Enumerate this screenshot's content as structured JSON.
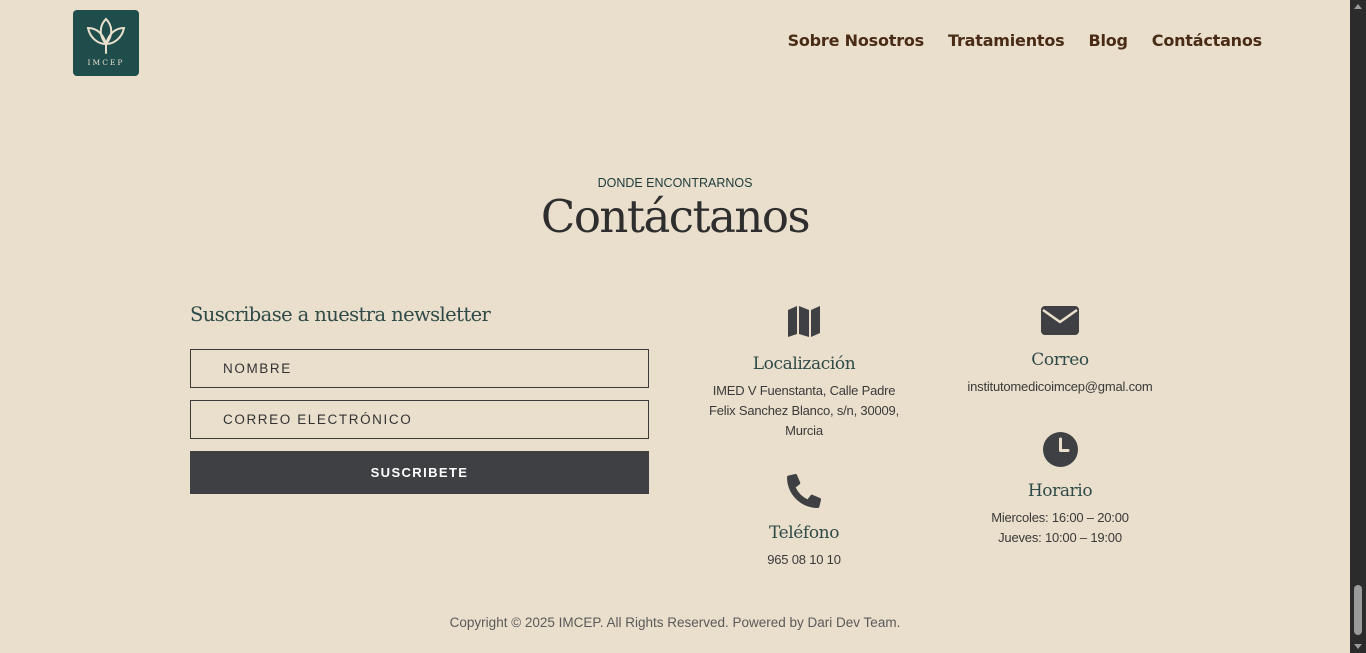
{
  "header": {
    "logo_text": "IMCEP",
    "nav": [
      {
        "label": "Sobre Nosotros"
      },
      {
        "label": "Tratamientos"
      },
      {
        "label": "Blog"
      },
      {
        "label": "Contáctanos"
      }
    ]
  },
  "section": {
    "eyebrow": "DONDE ENCONTRARNOS",
    "title": "Contáctanos"
  },
  "newsletter": {
    "title": "Suscribase a nuestra newsletter",
    "name_placeholder": "NOMBRE",
    "email_placeholder": "CORREO ELECTRÓNICO",
    "button_label": "SUSCRIBETE"
  },
  "info": {
    "location": {
      "icon": "map-icon",
      "title": "Localización",
      "lines": [
        "IMED V Fuenstanta, Calle Padre",
        "Felix Sanchez Blanco, s/n, 30009,",
        "Murcia"
      ]
    },
    "email": {
      "icon": "envelope-icon",
      "title": "Correo",
      "value": "institutomedicoimcep@gmal.com"
    },
    "phone": {
      "icon": "phone-icon",
      "title": "Teléfono",
      "value": "965 08 10 10"
    },
    "hours": {
      "icon": "clock-icon",
      "title": "Horario",
      "lines": [
        "Miercoles: 16:00 – 20:00",
        "Jueves: 10:00 – 19:00"
      ]
    }
  },
  "footer": {
    "copyright": "Copyright © 2025 IMCEP. All Rights Reserved. Powered by Dari Dev Team."
  },
  "colors": {
    "background": "#e9dfcc",
    "brand_teal": "#1f4d4c",
    "nav_text": "#4a2c16",
    "button": "#3e4043"
  }
}
